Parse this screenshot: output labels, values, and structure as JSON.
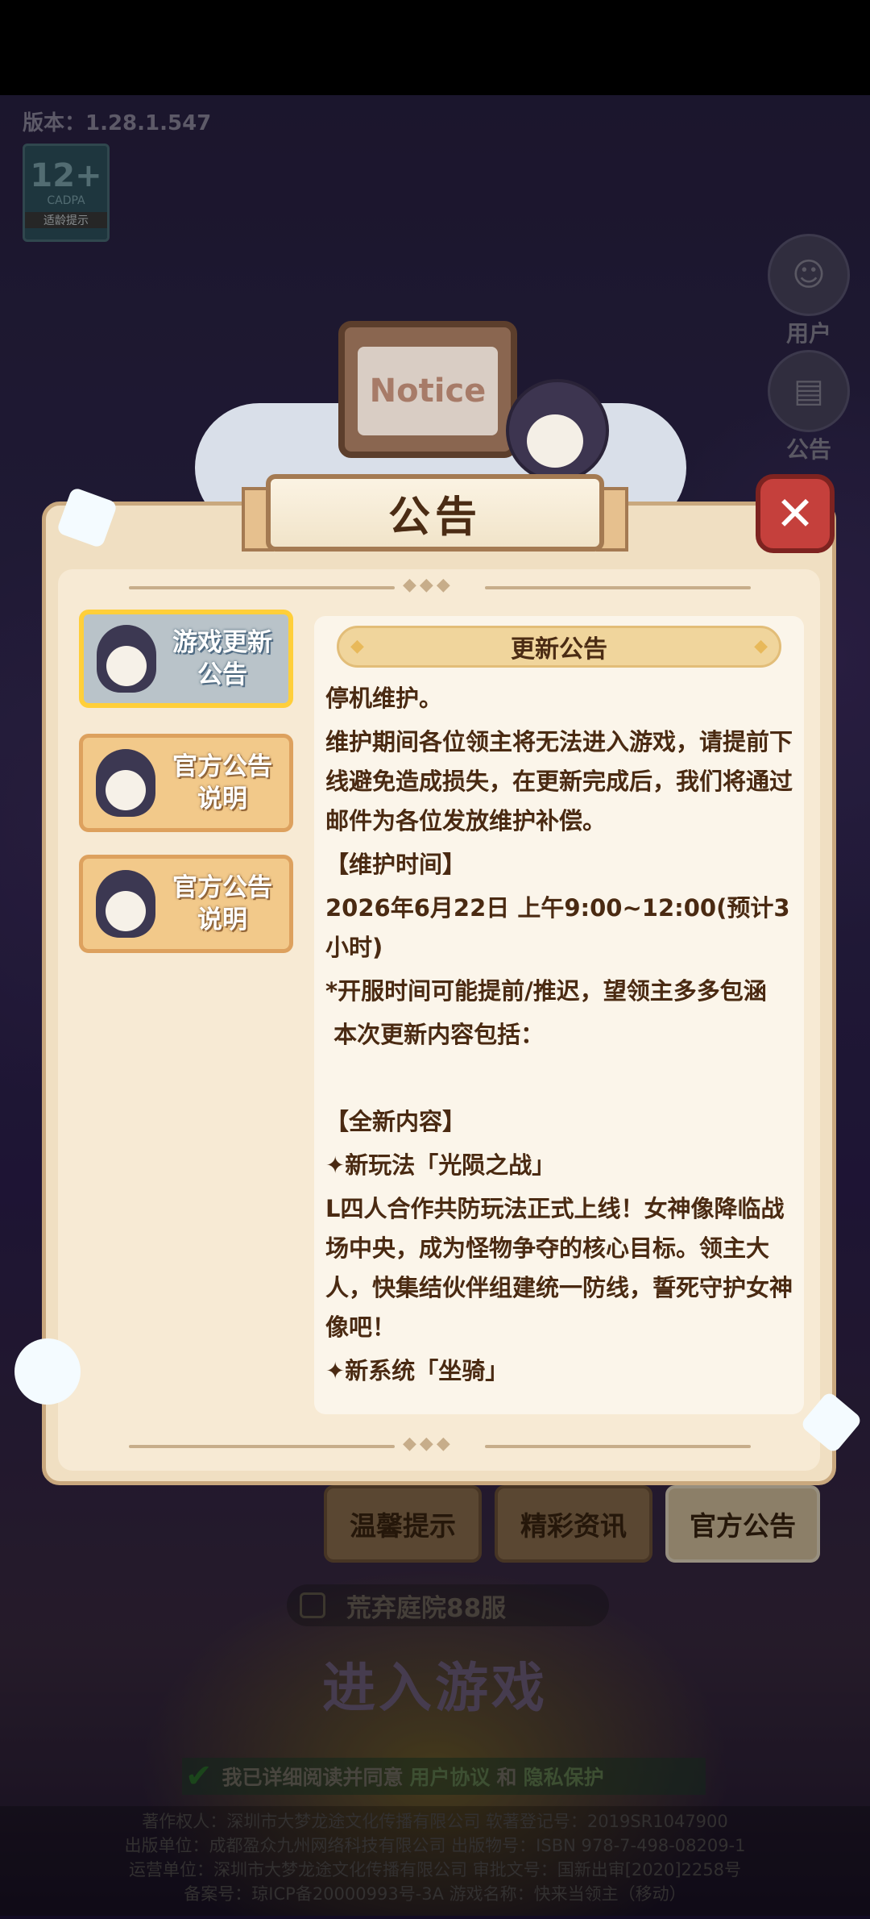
{
  "version_label": "版本：1.28.1.547",
  "age_badge": {
    "rating": "12+",
    "org": "CADPA",
    "caption": "适龄提示"
  },
  "side_buttons": [
    {
      "label": "用户",
      "icon": "user-icon"
    },
    {
      "label": "公告",
      "icon": "notice-icon"
    }
  ],
  "notice_sign": "Notice",
  "modal": {
    "title": "公告",
    "close_icon": "close-icon",
    "tabs": [
      {
        "label_line1": "游戏更新",
        "label_line2": "公告",
        "active": true
      },
      {
        "label_line1": "官方公告",
        "label_line2": "说明",
        "active": false
      },
      {
        "label_line1": "官方公告",
        "label_line2": "说明",
        "active": false
      }
    ],
    "content_title": "更新公告",
    "paragraphs": [
      "停机维护。",
      "维护期间各位领主将无法进入游戏，请提前下线避免造成损失，在更新完成后，我们将通过邮件为各位发放维护补偿。",
      "【维护时间】",
      "2026年6月22日 上午9:00~12:00(预计3小时)",
      "*开服时间可能提前/推迟，望领主多多包涵",
      " 本次更新内容包括：",
      "",
      "【全新内容】",
      "✦新玩法「光陨之战」",
      "L四人合作共防玩法正式上线！女神像降临战场中央，成为怪物争夺的核心目标。领主大人，快集结伙伴组建统一防线，誓死守护女神像吧！",
      "✦新系统「坐骑」"
    ]
  },
  "bottom_tabs": [
    "温馨提示",
    "精彩资讯",
    "官方公告"
  ],
  "server_name": "荒弃庭院88服",
  "enter_game": "进入游戏",
  "agreement": {
    "prefix": "我已详细阅读并同意",
    "user_link": "用户协议",
    "and": "和",
    "privacy_link": "隐私保护"
  },
  "credits": [
    "著作权人：深圳市大梦龙途文化传播有限公司  软著登记号：2019SR1047900",
    "出版单位：成都盈众九州网络科技有限公司  出版物号：ISBN 978-7-498-08209-1",
    "运营单位：深圳市大梦龙途文化传播有限公司  审批文号：国新出审[2020]2258号",
    "备案号：琼ICP备20000993号-3A 游戏名称：快来当领主（移动）"
  ],
  "colors": {
    "modal_bg": "#f0dfc2",
    "close_red": "#c5403c",
    "active_tab_border": "#ffcf3a",
    "title_brown": "#4b2c14"
  }
}
